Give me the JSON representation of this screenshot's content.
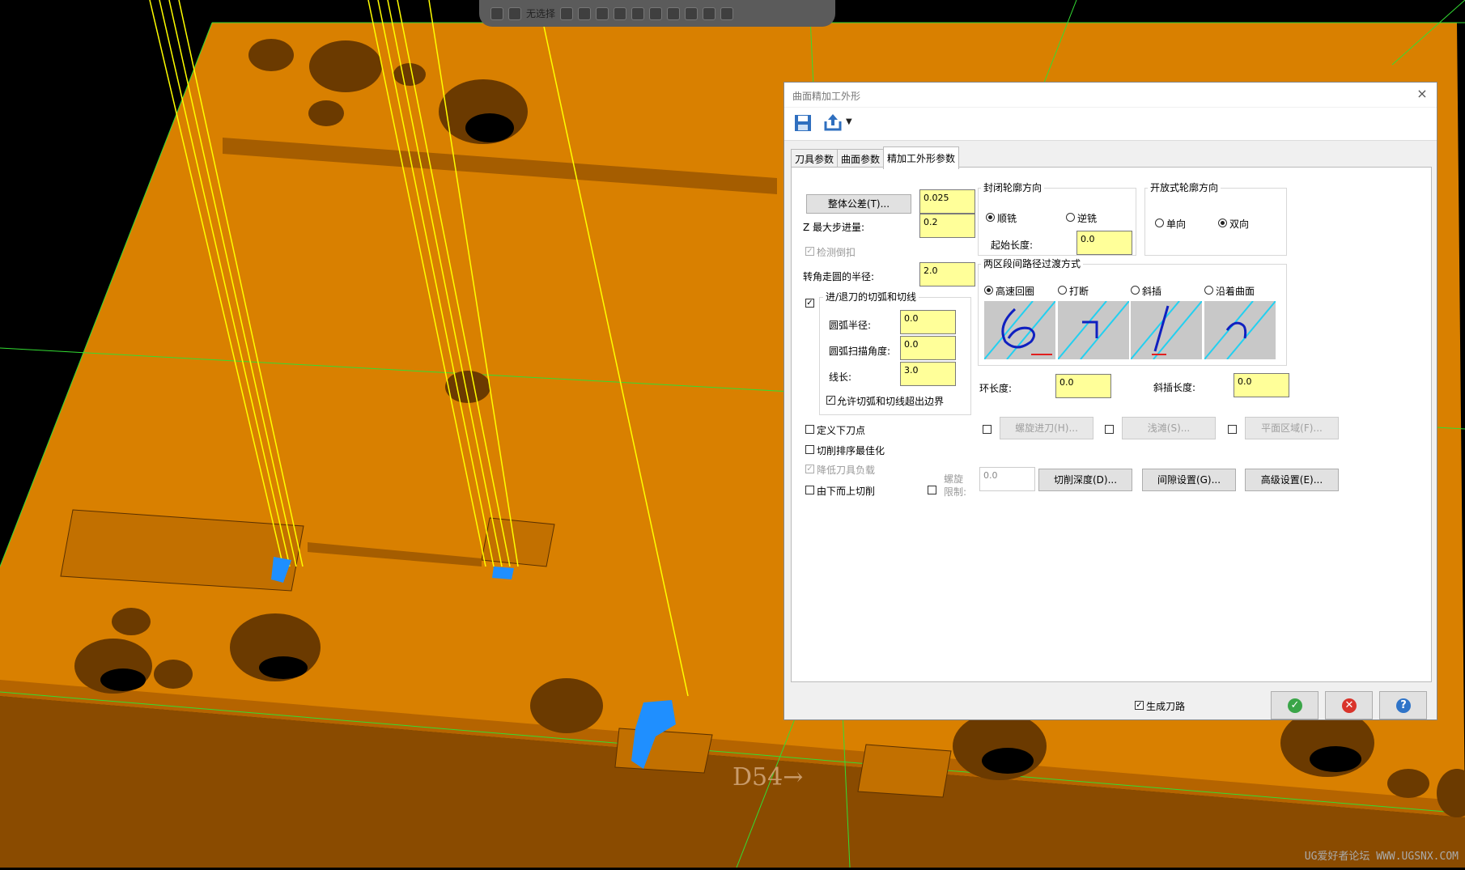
{
  "viewport": {
    "toolbar_label": "无选择",
    "part_label": "D54→",
    "watermark": "UG爱好者论坛 WWW.UGSNX.COM"
  },
  "dialog": {
    "title": "曲面精加工外形",
    "close": "×",
    "tabs": [
      "刀具参数",
      "曲面参数",
      "精加工外形参数"
    ],
    "active_tab": 2,
    "left": {
      "tolerance_button": "整体公差(T)...",
      "tolerance_value": "0.025",
      "z_step_label": "Z 最大步进量:",
      "z_step_value": "0.2",
      "check_undercut_label": "检测倒扣",
      "corner_radius_label": "转角走圆的半径:",
      "corner_radius_value": "2.0",
      "entry_group_title": "进/退刀的切弧和切线",
      "arc_radius_label": "圆弧半径:",
      "arc_radius_value": "0.0",
      "arc_sweep_label": "圆弧扫描角度:",
      "arc_sweep_value": "0.0",
      "line_length_label": "线长:",
      "line_length_value": "3.0",
      "allow_exceed_label": "允许切弧和切线超出边界",
      "define_plunge_label": "定义下刀点",
      "optimize_order_label": "切削排序最佳化",
      "reduce_load_label": "降低刀具负载",
      "bottom_up_label": "由下而上切削"
    },
    "closed_contour": {
      "title": "封闭轮廓方向",
      "climb": "顺铣",
      "conventional": "逆铣",
      "start_length_label": "起始长度:",
      "start_length_value": "0.0"
    },
    "open_contour": {
      "title": "开放式轮廓方向",
      "one_way": "单向",
      "two_way": "双向"
    },
    "transition": {
      "title": "两区段间路径过渡方式",
      "options": [
        "高速回圈",
        "打断",
        "斜插",
        "沿着曲面"
      ],
      "selected": 0
    },
    "loop_length_label": "环长度:",
    "loop_length_value": "0.0",
    "ramp_length_label": "斜插长度:",
    "ramp_length_value": "0.0",
    "helix_entry_button": "螺旋进刀(H)...",
    "shallow_button": "浅滩(S)...",
    "flat_area_button": "平面区域(F)...",
    "helix_limit_label_1": "螺旋",
    "helix_limit_label_2": "限制:",
    "helix_limit_value": "0.0",
    "depth_button": "切削深度(D)...",
    "gap_button": "间隙设置(G)...",
    "advanced_button": "高级设置(E)...",
    "generate_toolpath_label": "生成刀路",
    "colors": {
      "field_yellow": "#ffff99",
      "ok_green": "#3aa548",
      "cancel_red": "#d9342b",
      "help_blue": "#2f74c8"
    }
  }
}
